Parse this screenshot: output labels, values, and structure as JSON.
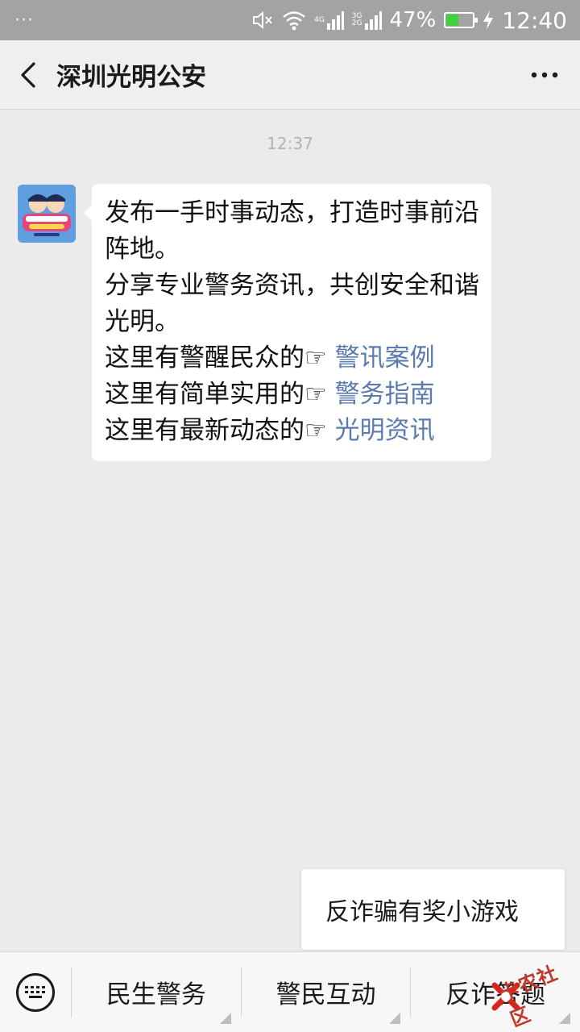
{
  "status_bar": {
    "notification_dots": "···",
    "net_4g": "4G",
    "net_3g": "3G",
    "net_2g": "2G",
    "battery_percent": "47%",
    "battery_level": 0.47,
    "time": "12:40"
  },
  "header": {
    "title": "深圳光明公安"
  },
  "chat": {
    "timestamp": "12:37",
    "message": {
      "line1": "发布一手时事动态，打造时事前沿阵地。",
      "line2": "分享专业警务资讯，共创安全和谐光明。",
      "row1_prefix": "这里有警醒民众的",
      "row1_link": "警讯案例",
      "row2_prefix": "这里有简单实用的",
      "row2_link": "警务指南",
      "row3_prefix": "这里有最新动态的",
      "row3_link": "光明资讯",
      "hand_symbol": "☞"
    }
  },
  "popup_menu": {
    "item1": "反诈骗有奖小游戏"
  },
  "bottom_menu": {
    "items": [
      "民生警务",
      "警民互动",
      "反诈答题"
    ]
  },
  "watermark": {
    "text": "卡农社区"
  },
  "colors": {
    "link": "#5a7bb0",
    "status_bar": "#a3a3a3",
    "background": "#ebebeb"
  }
}
